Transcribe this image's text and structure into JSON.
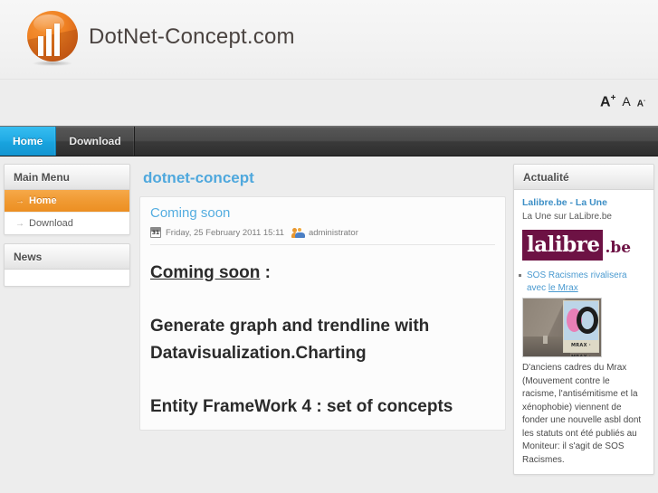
{
  "header": {
    "logo_text": "DotNet-Concept.com",
    "logo_icon": "orange-circle-barchart-logo",
    "font_sizer": {
      "increase": "A",
      "increase_sup": "+",
      "normal": "A",
      "decrease": "A",
      "decrease_sup": "-"
    }
  },
  "nav": {
    "items": [
      {
        "label": "Home",
        "active": true
      },
      {
        "label": "Download",
        "active": false
      }
    ]
  },
  "sidebar_left": {
    "modules": [
      {
        "title": "Main Menu",
        "items": [
          {
            "label": "Home",
            "active": true,
            "arrow": "→"
          },
          {
            "label": "Download",
            "active": false,
            "arrow": "→"
          }
        ]
      },
      {
        "title": "News",
        "items": []
      }
    ]
  },
  "main": {
    "page_title": "dotnet-concept",
    "article": {
      "title": "Coming soon",
      "meta": {
        "calendar_icon": "calendar-icon",
        "calendar_day": "31",
        "date": "Friday, 25 February 2011 15:11",
        "author_icon": "user-icon",
        "author": "administrator"
      },
      "body": {
        "heading_underlined": "Coming soon",
        "heading_suffix": " :",
        "paragraphs": [
          "Generate graph and trendline with Datavisualization.Charting",
          "Entity FrameWork 4 : set of concepts"
        ]
      }
    }
  },
  "sidebar_right": {
    "module_title": "Actualité",
    "feed": {
      "title": "Lalibre.be - La Une",
      "description": "La Une sur LaLibre.be",
      "logo": {
        "word": "lalibre",
        "suffix": ".be",
        "icon": "lalibre-be-logo"
      },
      "items": [
        {
          "text_line1": "SOS Racismes rivalisera avec",
          "text_line2": "le Mrax",
          "thumb_icon": "news-photo-thumbnail",
          "thumb_caption": "MRAX · MRAX ·",
          "body": "D'anciens cadres du Mrax (Mouvement contre le racisme, l'antisémitisme et la xénophobie) viennent de fonder une nouvelle asbl dont les statuts ont été publiés au Moniteur: il s'agit de SOS Racismes."
        }
      ]
    }
  },
  "colors": {
    "accent_orange": "#ef8f26",
    "accent_blue": "#4fa8dd",
    "nav_active": "#1aa5e0",
    "page_bg": "#ededed",
    "lalibre_purple": "#6d1244"
  }
}
